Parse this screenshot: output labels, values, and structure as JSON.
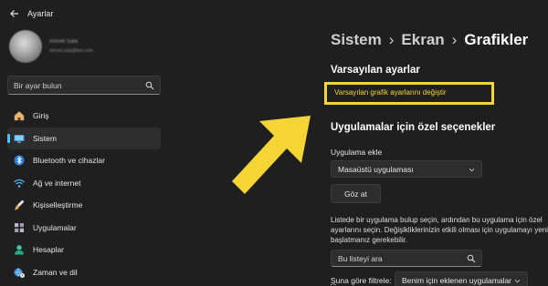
{
  "window": {
    "title": "Ayarlar"
  },
  "profile": {
    "name": "Ahmet Sala",
    "email": "ahmet.sala@live.com"
  },
  "search": {
    "placeholder": "Bir ayar bulun"
  },
  "sidebar": {
    "items": [
      {
        "label": "Giriş",
        "icon": "home-icon",
        "active": false
      },
      {
        "label": "Sistem",
        "icon": "system-display-icon",
        "active": true
      },
      {
        "label": "Bluetooth ve cihazlar",
        "icon": "bluetooth-icon",
        "active": false
      },
      {
        "label": "Ağ ve internet",
        "icon": "wifi-icon",
        "active": false
      },
      {
        "label": "Kişiselleştirme",
        "icon": "brush-icon",
        "active": false
      },
      {
        "label": "Uygulamalar",
        "icon": "apps-icon",
        "active": false
      },
      {
        "label": "Hesaplar",
        "icon": "person-icon",
        "active": false
      },
      {
        "label": "Zaman ve dil",
        "icon": "globe-clock-icon",
        "active": false
      }
    ]
  },
  "breadcrumb": {
    "part1": "Sistem",
    "part2": "Ekran",
    "current": "Grafikler",
    "separator": "›"
  },
  "main": {
    "default_settings": {
      "title": "Varsayılan ayarlar",
      "link": "Varsayılan grafik ayarlarını değiştir"
    },
    "custom_options": {
      "title": "Uygulamalar için özel seçenekler",
      "add_app_label": "Uygulama ekle",
      "app_type_value": "Masaüstü uygulaması",
      "browse_button": "Göz at",
      "description_lines": [
        "Listede bir uygulama bulup seçin, ardından bu uygulama için özel",
        "ayarlarını seçin. Değişikliklerinizin etkili olması için uygulamayı yeniden",
        "başlatmanız gerekebilir."
      ],
      "list_search_placeholder": "Bu listeyi ara",
      "filter_label_accel": "Ş",
      "filter_label_rest": "una göre filtrele:",
      "filter_value": "Benim için eklenen uygulamalar"
    }
  },
  "colors": {
    "background": "#1f1f1f",
    "accent": "#4cc2ff",
    "highlight": "#f5d535"
  }
}
